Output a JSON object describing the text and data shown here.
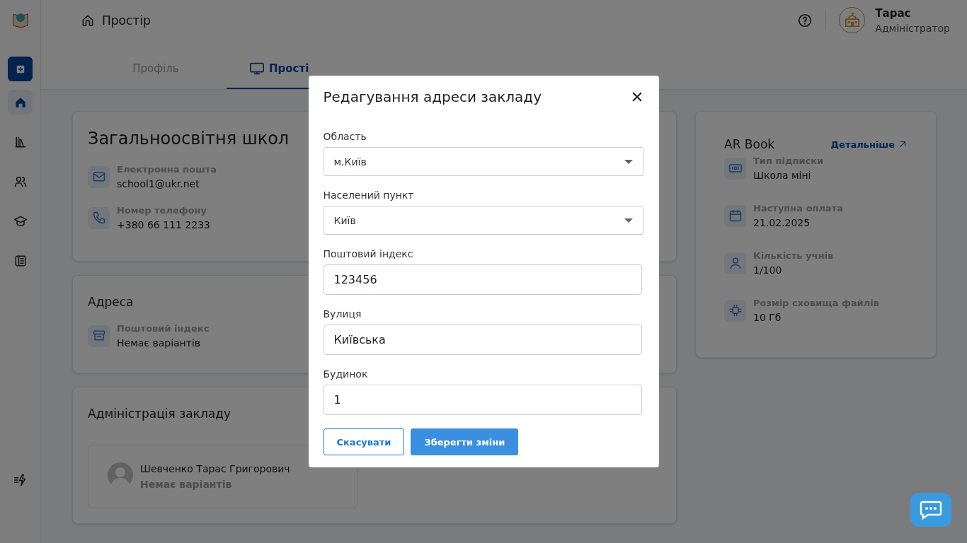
{
  "header": {
    "breadcrumb": "Простір",
    "user": {
      "name": "Тарас",
      "role": "Адміністратор"
    }
  },
  "sidebar": {
    "items": [
      {
        "selected": true
      },
      {
        "selected": false
      },
      {
        "selected": false
      },
      {
        "selected": false
      },
      {
        "selected": false
      }
    ]
  },
  "tabs": [
    {
      "label": "Профіль",
      "selected": false
    },
    {
      "label": "Прості",
      "selected": true
    }
  ],
  "school_card": {
    "title": "Загальноосвітня школ",
    "rows": [
      {
        "label": "Електронна пошта",
        "value": "school1@ukr.net"
      },
      {
        "label": "Номер телефону",
        "value": "+380 66 111 2233"
      }
    ]
  },
  "address_card": {
    "title": "Адреса",
    "rows": [
      {
        "label": "Поштовий індекс",
        "value": "Немає варіантів"
      }
    ]
  },
  "admin_card": {
    "title": "Адміністрація закладу",
    "person": {
      "name": "Шевченко Тарас Григорович",
      "detail": "Немає варіантів"
    }
  },
  "subscription_card": {
    "title": "AR Book",
    "link": "Детальніше",
    "rows": [
      {
        "label": "Тип підписки",
        "value": "Школа міні"
      },
      {
        "label": "Наступна оплата",
        "value": "21.02.2025"
      },
      {
        "label": "Кількість учнів",
        "value": "1/100"
      },
      {
        "label": "Розмір сховища файлів",
        "value": "10 Гб"
      }
    ]
  },
  "dialog": {
    "title": "Редагування адреси закладу",
    "fields": [
      {
        "kind": "select",
        "label": "Область",
        "value": "м.Київ"
      },
      {
        "kind": "select",
        "label": "Населений пункт",
        "value": "Київ"
      },
      {
        "kind": "text",
        "label": "Поштовий індекс",
        "value": "123456"
      },
      {
        "kind": "text",
        "label": "Вулиця",
        "value": "Київська"
      },
      {
        "kind": "text",
        "label": "Будинок",
        "value": "1"
      }
    ],
    "buttons": [
      {
        "kind": "secondary",
        "label": "Скасувати"
      },
      {
        "kind": "primary",
        "label": "Зберегти зміни"
      }
    ]
  }
}
